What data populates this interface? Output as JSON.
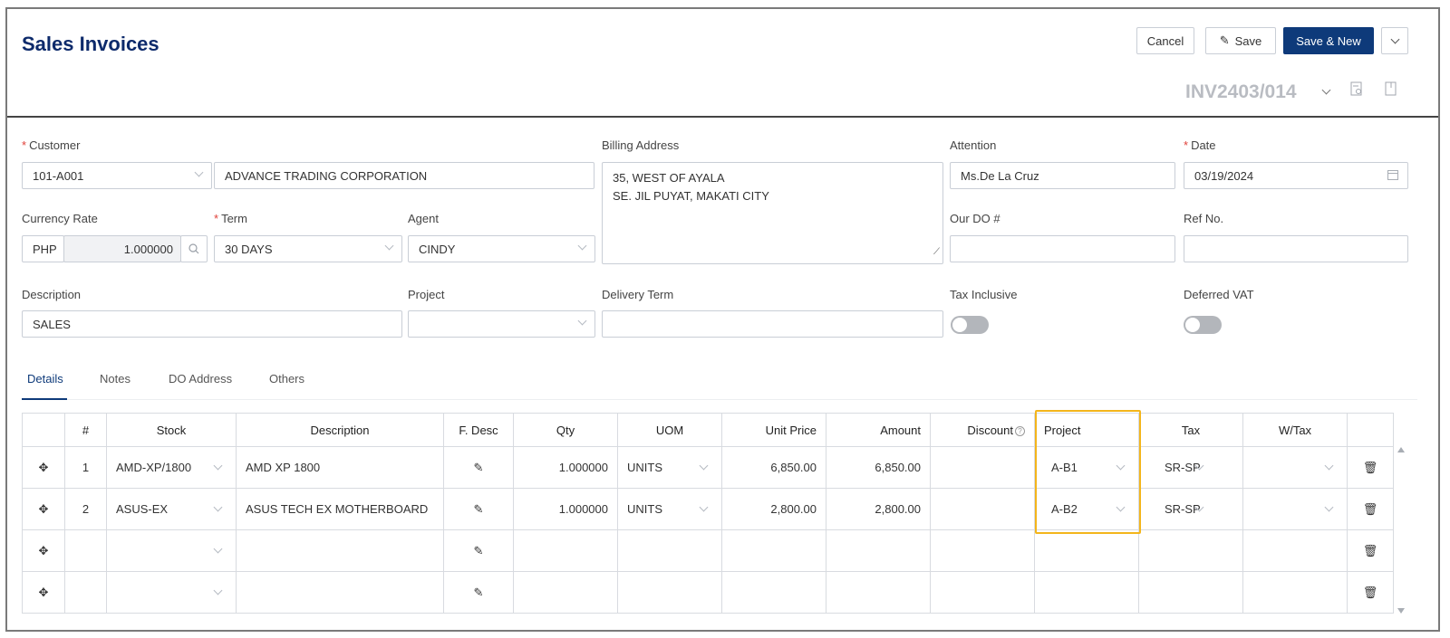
{
  "header": {
    "title": "Sales Invoices",
    "cancel_label": "Cancel",
    "save_label": "Save",
    "save_new_label": "Save & New",
    "invoice_number": "INV2403/014"
  },
  "form": {
    "customer": {
      "label": "Customer",
      "code": "101-A001",
      "name": "ADVANCE TRADING CORPORATION"
    },
    "billing_address": {
      "label": "Billing Address",
      "line1": "35, WEST OF AYALA",
      "line2": "SE. JIL PUYAT, MAKATI CITY"
    },
    "attention": {
      "label": "Attention",
      "value": "Ms.De La Cruz"
    },
    "date": {
      "label": "Date",
      "value": "03/19/2024"
    },
    "currency_rate": {
      "label": "Currency Rate",
      "currency": "PHP",
      "rate": "1.000000"
    },
    "term": {
      "label": "Term",
      "value": "30 DAYS"
    },
    "agent": {
      "label": "Agent",
      "value": "CINDY"
    },
    "our_do": {
      "label": "Our DO #",
      "value": ""
    },
    "ref_no": {
      "label": "Ref No.",
      "value": ""
    },
    "description": {
      "label": "Description",
      "value": "SALES"
    },
    "project": {
      "label": "Project",
      "value": ""
    },
    "delivery_term": {
      "label": "Delivery Term",
      "value": ""
    },
    "tax_inclusive": {
      "label": "Tax Inclusive",
      "on": false
    },
    "deferred_vat": {
      "label": "Deferred VAT",
      "on": false
    }
  },
  "tabs": [
    "Details",
    "Notes",
    "DO Address",
    "Others"
  ],
  "grid": {
    "columns": [
      "",
      "#",
      "Stock",
      "Description",
      "F. Desc",
      "Qty",
      "UOM",
      "Unit Price",
      "Amount",
      "Discount",
      "Project",
      "Tax",
      "W/Tax",
      ""
    ],
    "rows": [
      {
        "no": "1",
        "stock": "AMD-XP/1800",
        "description": "AMD XP 1800",
        "qty": "1.000000",
        "uom": "UNITS",
        "unit_price": "6,850.00",
        "amount": "6,850.00",
        "discount": "",
        "project": "A-B1",
        "tax": "SR-SP",
        "wtax": ""
      },
      {
        "no": "2",
        "stock": "ASUS-EX",
        "description": "ASUS TECH EX MOTHERBOARD",
        "qty": "1.000000",
        "uom": "UNITS",
        "unit_price": "2,800.00",
        "amount": "2,800.00",
        "discount": "",
        "project": "A-B2",
        "tax": "SR-SP",
        "wtax": ""
      },
      {
        "no": "",
        "stock": "",
        "description": "",
        "qty": "",
        "uom": "",
        "unit_price": "",
        "amount": "",
        "discount": "",
        "project": "",
        "tax": "",
        "wtax": ""
      },
      {
        "no": "",
        "stock": "",
        "description": "",
        "qty": "",
        "uom": "",
        "unit_price": "",
        "amount": "",
        "discount": "",
        "project": "",
        "tax": "",
        "wtax": ""
      }
    ]
  },
  "colors": {
    "brand": "#0e3a7a",
    "highlight": "#f3b51b",
    "trash": "#3a9be0"
  }
}
